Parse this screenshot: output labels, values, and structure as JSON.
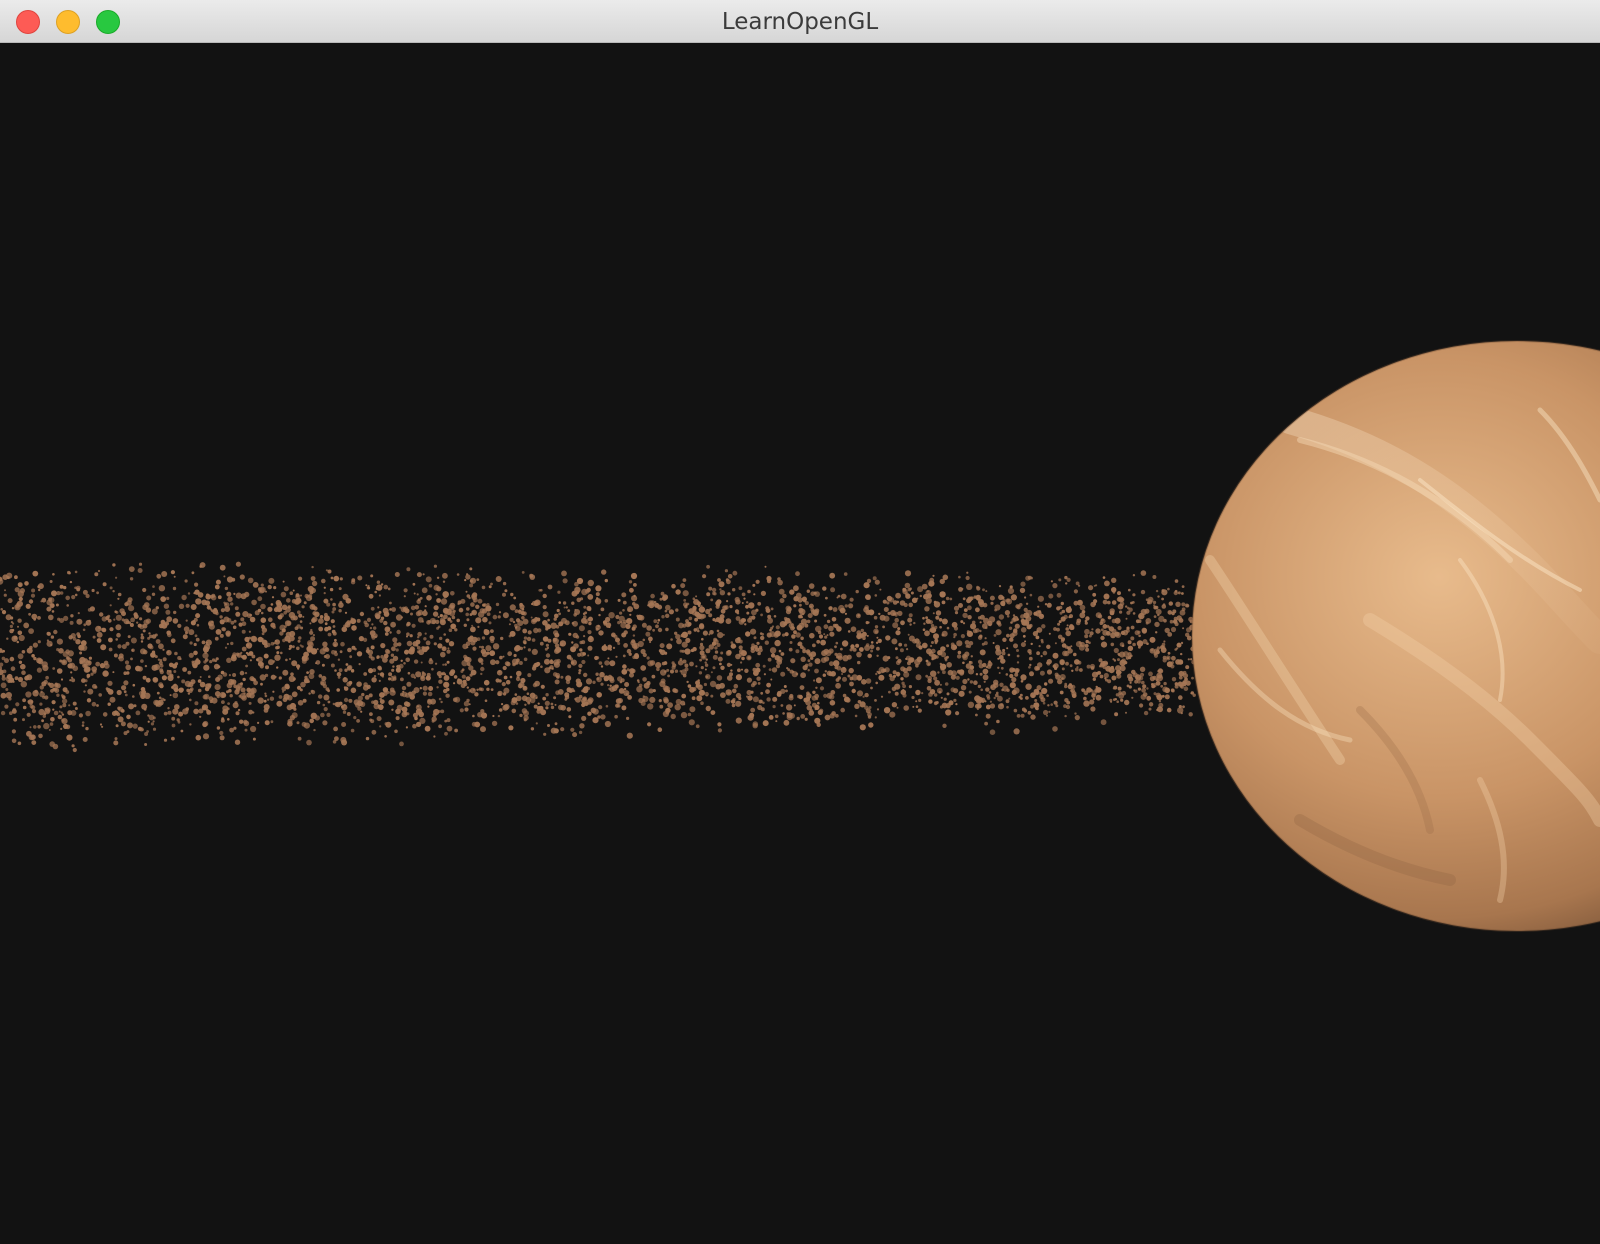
{
  "window": {
    "title": "LearnOpenGL",
    "controls": {
      "close": "close-button",
      "minimize": "minimize-button",
      "zoom": "zoom-button"
    }
  },
  "scene": {
    "background_color": "#121212",
    "planet_colors": [
      "#f2cfa8",
      "#c99466",
      "#a8764e",
      "#7a5438"
    ],
    "asteroid_color": "#a57655"
  }
}
